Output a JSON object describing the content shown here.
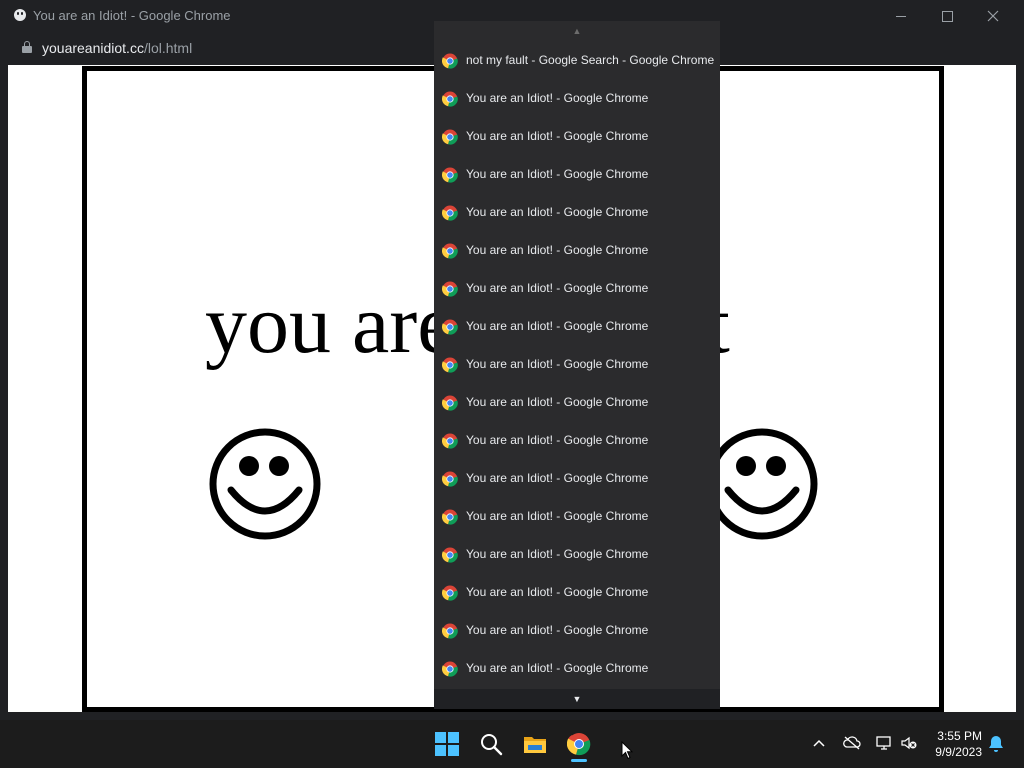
{
  "window": {
    "title": "You are an Idiot! - Google Chrome",
    "url_host": "youareanidiot.cc",
    "url_path": "/lol.html"
  },
  "page": {
    "big_text": "you are an idiot"
  },
  "tab_search": {
    "items": [
      {
        "label": "not my fault - Google Search - Google Chrome"
      },
      {
        "label": "You are an Idiot! - Google Chrome"
      },
      {
        "label": "You are an Idiot! - Google Chrome"
      },
      {
        "label": "You are an Idiot! - Google Chrome"
      },
      {
        "label": "You are an Idiot! - Google Chrome"
      },
      {
        "label": "You are an Idiot! - Google Chrome"
      },
      {
        "label": "You are an Idiot! - Google Chrome"
      },
      {
        "label": "You are an Idiot! - Google Chrome"
      },
      {
        "label": "You are an Idiot! - Google Chrome"
      },
      {
        "label": "You are an Idiot! - Google Chrome"
      },
      {
        "label": "You are an Idiot! - Google Chrome"
      },
      {
        "label": "You are an Idiot! - Google Chrome"
      },
      {
        "label": "You are an Idiot! - Google Chrome"
      },
      {
        "label": "You are an Idiot! - Google Chrome"
      },
      {
        "label": "You are an Idiot! - Google Chrome"
      },
      {
        "label": "You are an Idiot! - Google Chrome"
      },
      {
        "label": "You are an Idiot! - Google Chrome"
      }
    ]
  },
  "taskbar": {
    "time": "3:55 PM",
    "date": "9/9/2023",
    "pinned": [
      "start-icon",
      "search-icon",
      "file-explorer-icon",
      "chrome-icon"
    ]
  },
  "colors": {
    "chrome_dark": "#202124",
    "dropdown_bg": "#2b2b2d",
    "accent": "#4cc2ff"
  }
}
